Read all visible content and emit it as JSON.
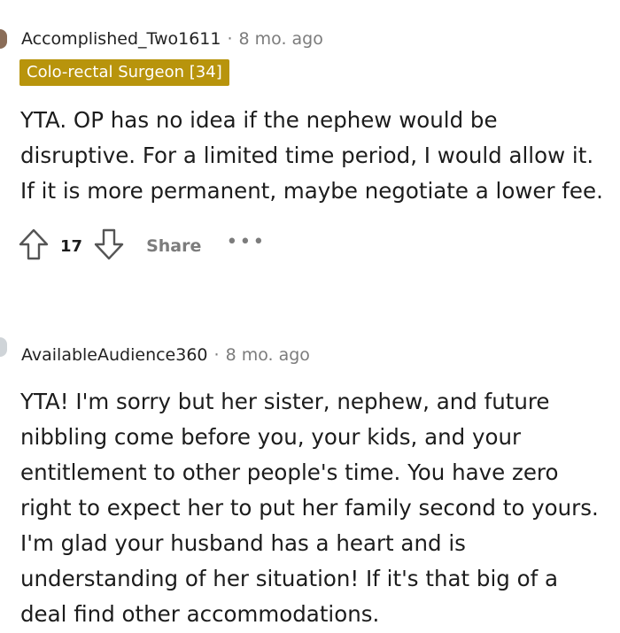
{
  "comments": [
    {
      "username": "Accomplished_Two1611",
      "separator": "·",
      "timestamp": "8 mo. ago",
      "flair": "Colo-rectal Surgeon [34]",
      "flair_color": "#b8940c",
      "body_lines": [
        "YTA. OP has no idea if the nephew would be",
        "disruptive. For a limited time period, I would allow it.",
        "If it is more permanent, maybe negotiate a lower fee."
      ],
      "vote_count": "17",
      "share_label": "Share",
      "more_label": "•••",
      "upvote_icon": "upvote-arrow-icon",
      "downvote_icon": "downvote-arrow-icon"
    },
    {
      "username": "AvailableAudience360",
      "separator": "·",
      "timestamp": "8 mo. ago",
      "body_lines": [
        "YTA! I'm sorry but her sister, nephew, and future",
        "nibbling come before you, your kids, and your",
        "entitlement to other people's time. You have zero",
        "right to expect her to put her family second to yours.",
        "I'm glad your husband has a heart and is",
        "understanding of her situation! If it's that big of a",
        "deal find other accommodations."
      ]
    }
  ],
  "colors": {
    "text": "#1c1c1c",
    "muted": "#7c7c7c",
    "background": "#ffffff"
  }
}
